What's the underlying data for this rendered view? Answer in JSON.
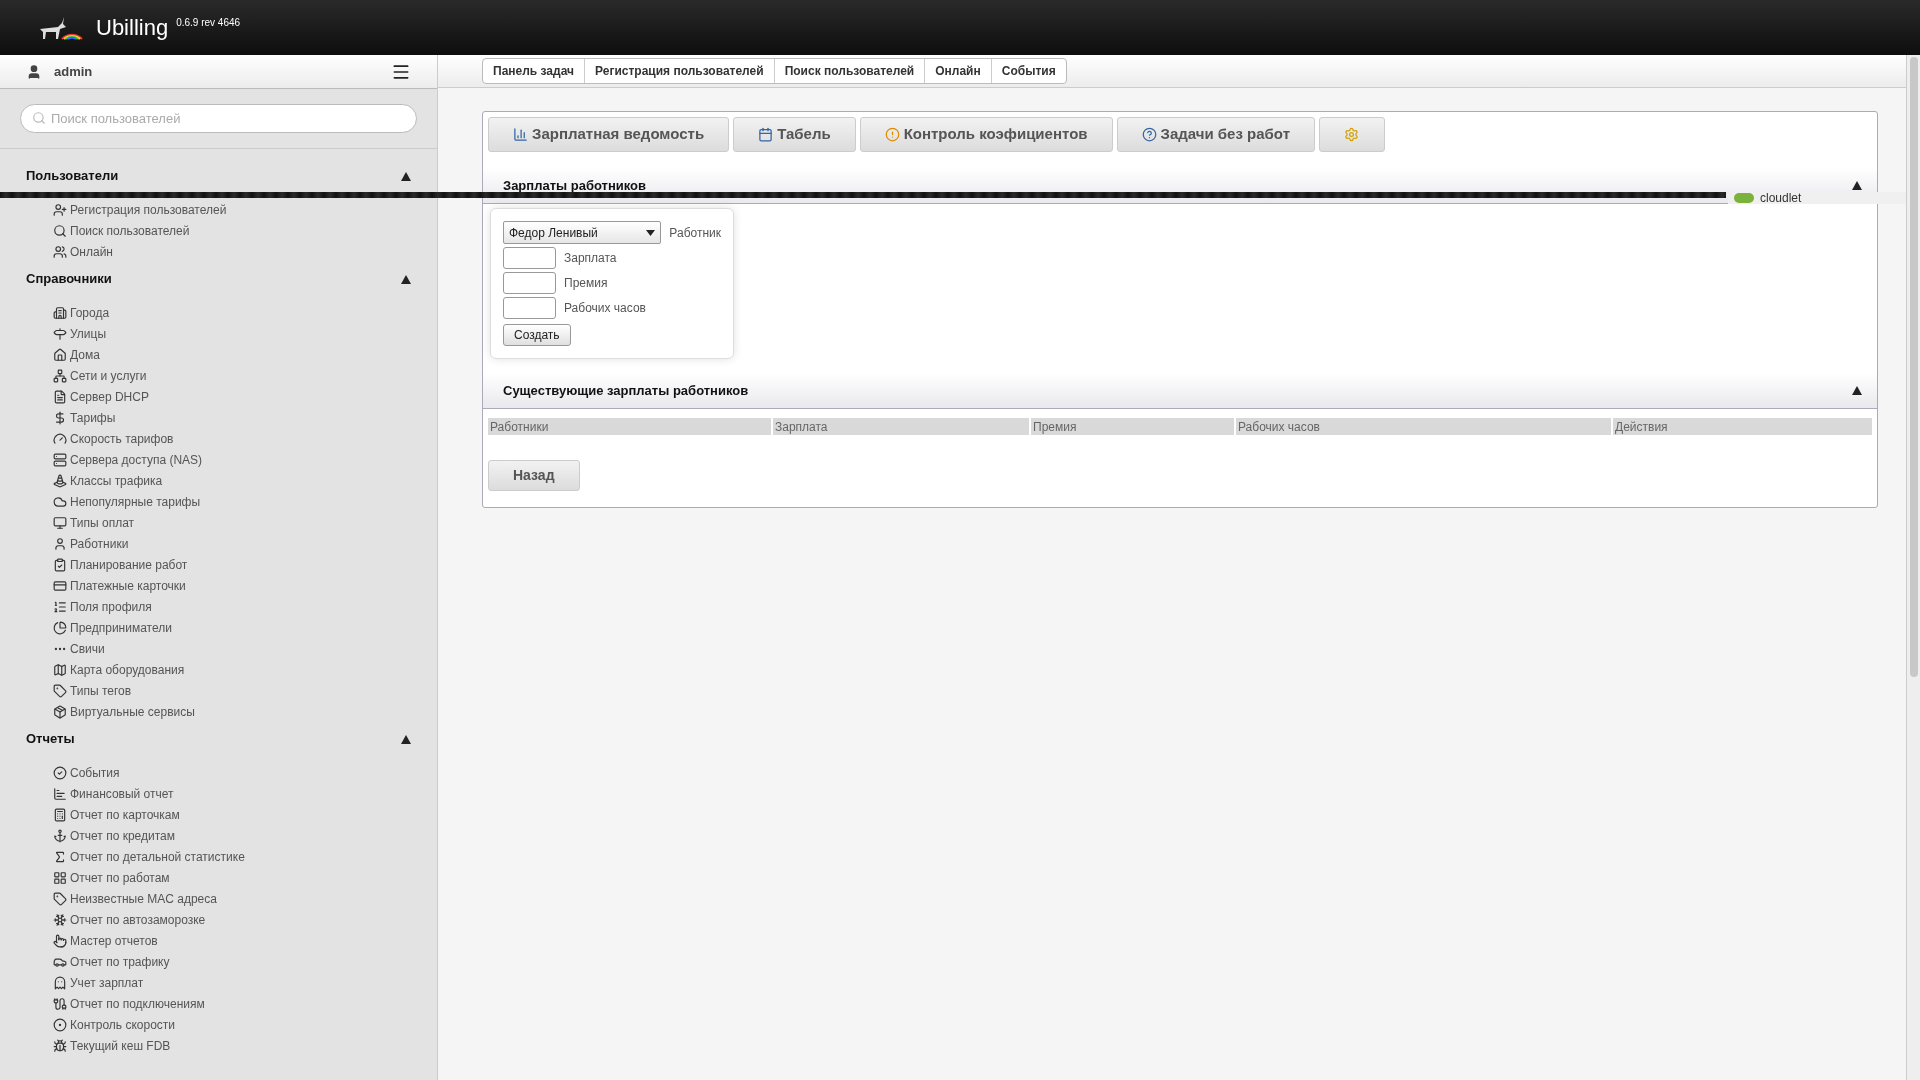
{
  "header": {
    "title": "Ubilling",
    "version": "0.6.9 rev 4646"
  },
  "user": {
    "name": "admin"
  },
  "search": {
    "placeholder": "Поиск пользователей"
  },
  "sidebar": [
    {
      "title": "Пользователи",
      "expanded": true,
      "items": [
        "Регистрация пользователей",
        "Поиск пользователей",
        "Онлайн"
      ]
    },
    {
      "title": "Справочники",
      "expanded": true,
      "items": [
        "Города",
        "Улицы",
        "Дома",
        "Сети и услуги",
        "Сервер DHCP",
        "Тарифы",
        "Скорость тарифов",
        "Сервера доступа (NAS)",
        "Классы трафика",
        "Непопулярные тарифы",
        "Типы оплат",
        "Работники",
        "Планирование работ",
        "Платежные карточки",
        "Поля профиля",
        "Предприниматели",
        "Свичи",
        "Карта оборудования",
        "Типы тегов",
        "Виртуальные сервисы"
      ]
    },
    {
      "title": "Отчеты",
      "expanded": true,
      "items": [
        "События",
        "Финансовый отчет",
        "Отчет по карточкам",
        "Отчет по кредитам",
        "Отчет по детальной статистике",
        "Отчет по работам",
        "Неизвестные MAC адреса",
        "Отчет по автозаморозке",
        "Мастер отчетов",
        "Отчет по трафику",
        "Учет зарплат",
        "Отчет по подключениям",
        "Контроль скорости",
        "Текущий кеш FDB"
      ]
    }
  ],
  "breadcrumbs": [
    "Панель задач",
    "Регистрация пользователей",
    "Поиск пользователей",
    "Онлайн",
    "События"
  ],
  "tabs": [
    {
      "kind": "text",
      "label": "Зарплатная ведомость"
    },
    {
      "kind": "text",
      "label": "Табель"
    },
    {
      "kind": "text",
      "label": "Контроль коэфициентов"
    },
    {
      "kind": "text",
      "label": "Задачи без работ"
    },
    {
      "kind": "icon"
    }
  ],
  "form_section": {
    "title": "Зарплаты работников",
    "expanded": true,
    "worker": {
      "value": "Федор Ленивый",
      "label": "Работник"
    },
    "fields": [
      {
        "label": "Зарплата"
      },
      {
        "label": "Премия"
      },
      {
        "label": "Рабочих часов"
      }
    ],
    "submit": "Создать"
  },
  "table_section": {
    "title": "Существующие зарплаты работников",
    "expanded": true,
    "columns": [
      "Работники",
      "Зарплата",
      "Премия",
      "Рабочих часов",
      "Действия"
    ]
  },
  "back_button": "Назад",
  "overlay": {
    "label": "cloudlet"
  }
}
